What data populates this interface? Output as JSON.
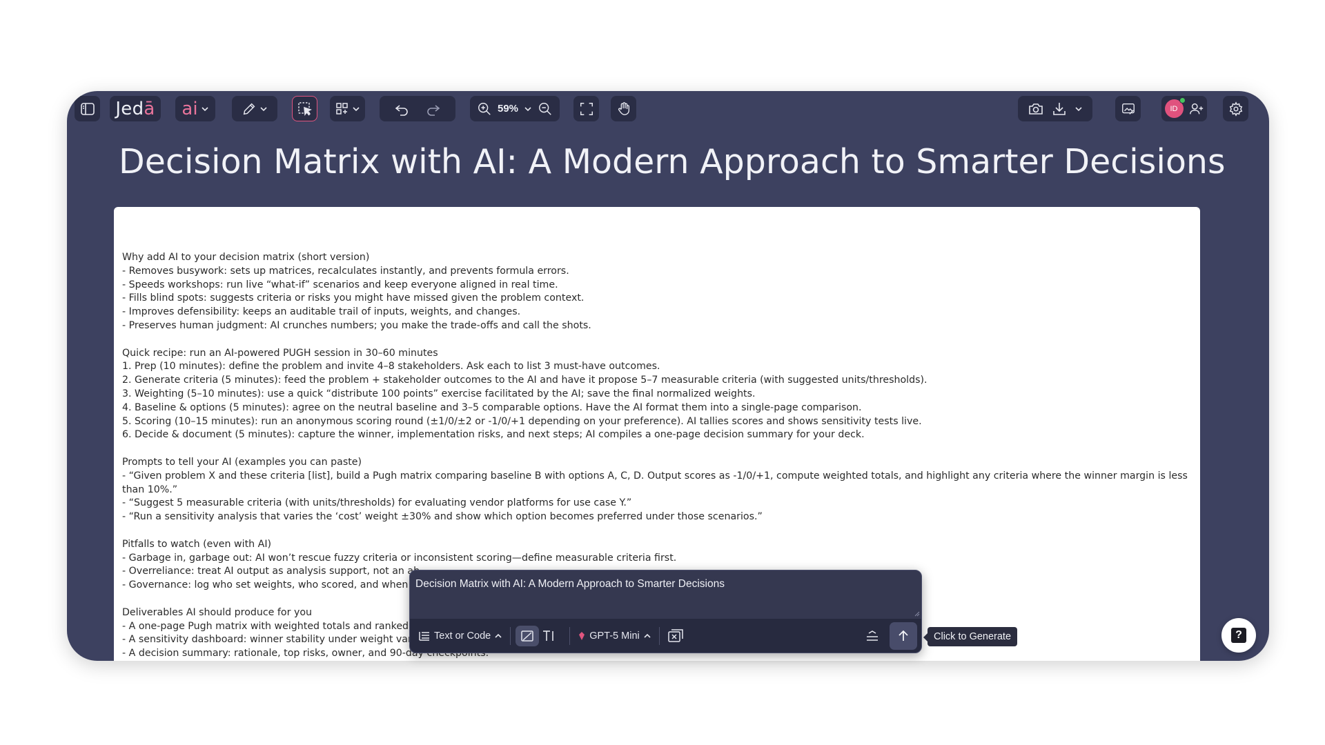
{
  "toolbar": {
    "logo_main": "Jed",
    "logo_accent": "ā",
    "ai_label": "ai",
    "zoom": "59%"
  },
  "page": {
    "title": "Decision Matrix with AI: A Modern Approach to Smarter Decisions"
  },
  "avatar": {
    "initials": "ID"
  },
  "document": {
    "lines": [
      "Why add AI to your decision matrix (short version)",
      "- Removes busywork: sets up matrices, recalculates instantly, and prevents formula errors.",
      "- Speeds workshops: run live “what-if” scenarios and keep everyone aligned in real time.",
      "- Fills blind spots: suggests criteria or risks you might have missed given the problem context.",
      "- Improves defensibility: keeps an auditable trail of inputs, weights, and changes.",
      "- Preserves human judgment: AI crunches numbers; you make the trade-offs and call the shots.",
      "",
      "Quick recipe: run an AI-powered PUGH session in 30–60 minutes",
      "1. Prep (10 minutes): define the problem and invite 4–8 stakeholders. Ask each to list 3 must-have outcomes.",
      "2. Generate criteria (5 minutes): feed the problem + stakeholder outcomes to the AI and have it propose 5–7 measurable criteria (with suggested units/thresholds).",
      "3. Weighting (5–10 minutes): use a quick “distribute 100 points” exercise facilitated by the AI; save the final normalized weights.",
      "4. Baseline & options (5 minutes): agree on the neutral baseline and 3–5 comparable options. Have the AI format them into a single-page comparison.",
      "5. Scoring (10–15 minutes): run an anonymous scoring round (±1/0/±2 or -1/0/+1 depending on your preference). AI tallies scores and shows sensitivity tests live.",
      "6. Decide & document (5 minutes): capture the winner, implementation risks, and next steps; AI compiles a one-page decision summary for your deck.",
      "",
      "Prompts to tell your AI (examples you can paste)",
      "- “Given problem X and these criteria [list], build a Pugh matrix comparing baseline B with options A, C, D. Output scores as -1/0/+1, compute weighted totals, and highlight any criteria where the winner margin is less than 10%.”",
      "- “Suggest 5 measurable criteria (with units/thresholds) for evaluating vendor platforms for use case Y.”",
      "- “Run a sensitivity analysis that varies the ‘cost’ weight ±30% and show which option becomes preferred under those scenarios.”",
      "",
      "Pitfalls to watch (even with AI)",
      "- Garbage in, garbage out: AI won’t rescue fuzzy criteria or inconsistent scoring—define measurable criteria first.",
      "- Overreliance: treat AI output as analysis support, not an ab",
      "- Governance: log who set weights, who scored, and when c",
      "",
      "Deliverables AI should produce for you",
      "- A one-page Pugh matrix with weighted totals and ranked o",
      "- A sensitivity dashboard: winner stability under weight vari",
      "- A decision summary: rationale, top risks, owner, and 90-day checkpoints."
    ]
  },
  "prompt": {
    "text": "Decision Matrix with AI: A Modern Approach to Smarter Decisions",
    "mode_label": "Text or Code",
    "model_label": "GPT-5 Mini"
  },
  "tooltip": {
    "text": "Click to Generate"
  },
  "help": {
    "label": "?"
  }
}
